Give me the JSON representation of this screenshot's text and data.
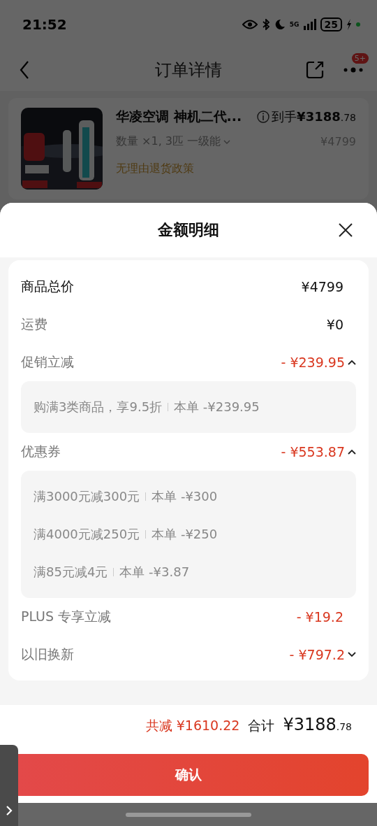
{
  "status_bar": {
    "time": "21:52",
    "network": "5G",
    "battery": "25"
  },
  "nav": {
    "title": "订单详情",
    "badge": "5+"
  },
  "product": {
    "kind": "picture",
    "name": "华凌空调 神机二代...",
    "price_label": "到手",
    "price": "¥3188",
    "price_decimal": ".78",
    "spec": "数量 ×1, 3匹 一级能",
    "original_price": "¥4799",
    "policy": "无理由退货政策"
  },
  "sheet": {
    "title": "金额明细",
    "rows": [
      {
        "kind": "total",
        "label": "商品总价",
        "amount": "¥4799"
      },
      {
        "kind": "plain",
        "label": "运费",
        "amount": "¥0"
      },
      {
        "kind": "discount",
        "label": "促销立减",
        "amount": "- ¥239.95",
        "expanded": true,
        "details": [
          {
            "condition": "购满3类商品，享9.5折",
            "amount": "本单 -¥239.95"
          }
        ]
      },
      {
        "kind": "discount",
        "label": "优惠券",
        "amount": "- ¥553.87",
        "expanded": true,
        "details": [
          {
            "condition": "满3000元减300元",
            "amount": "本单 -¥300"
          },
          {
            "condition": "满4000元减250元",
            "amount": "本单 -¥250"
          },
          {
            "condition": "满85元减4元",
            "amount": "本单 -¥3.87"
          }
        ]
      },
      {
        "kind": "discount",
        "label": "PLUS 专享立减",
        "amount": "- ¥19.2"
      },
      {
        "kind": "discount",
        "label": "以旧换新",
        "amount": "- ¥797.2",
        "expanded": false
      }
    ]
  },
  "footer": {
    "saved_label": "共减",
    "saved": "¥1610.22",
    "total_label": "合计",
    "total": "¥3188",
    "total_decimal": ".78",
    "button": "确认"
  }
}
